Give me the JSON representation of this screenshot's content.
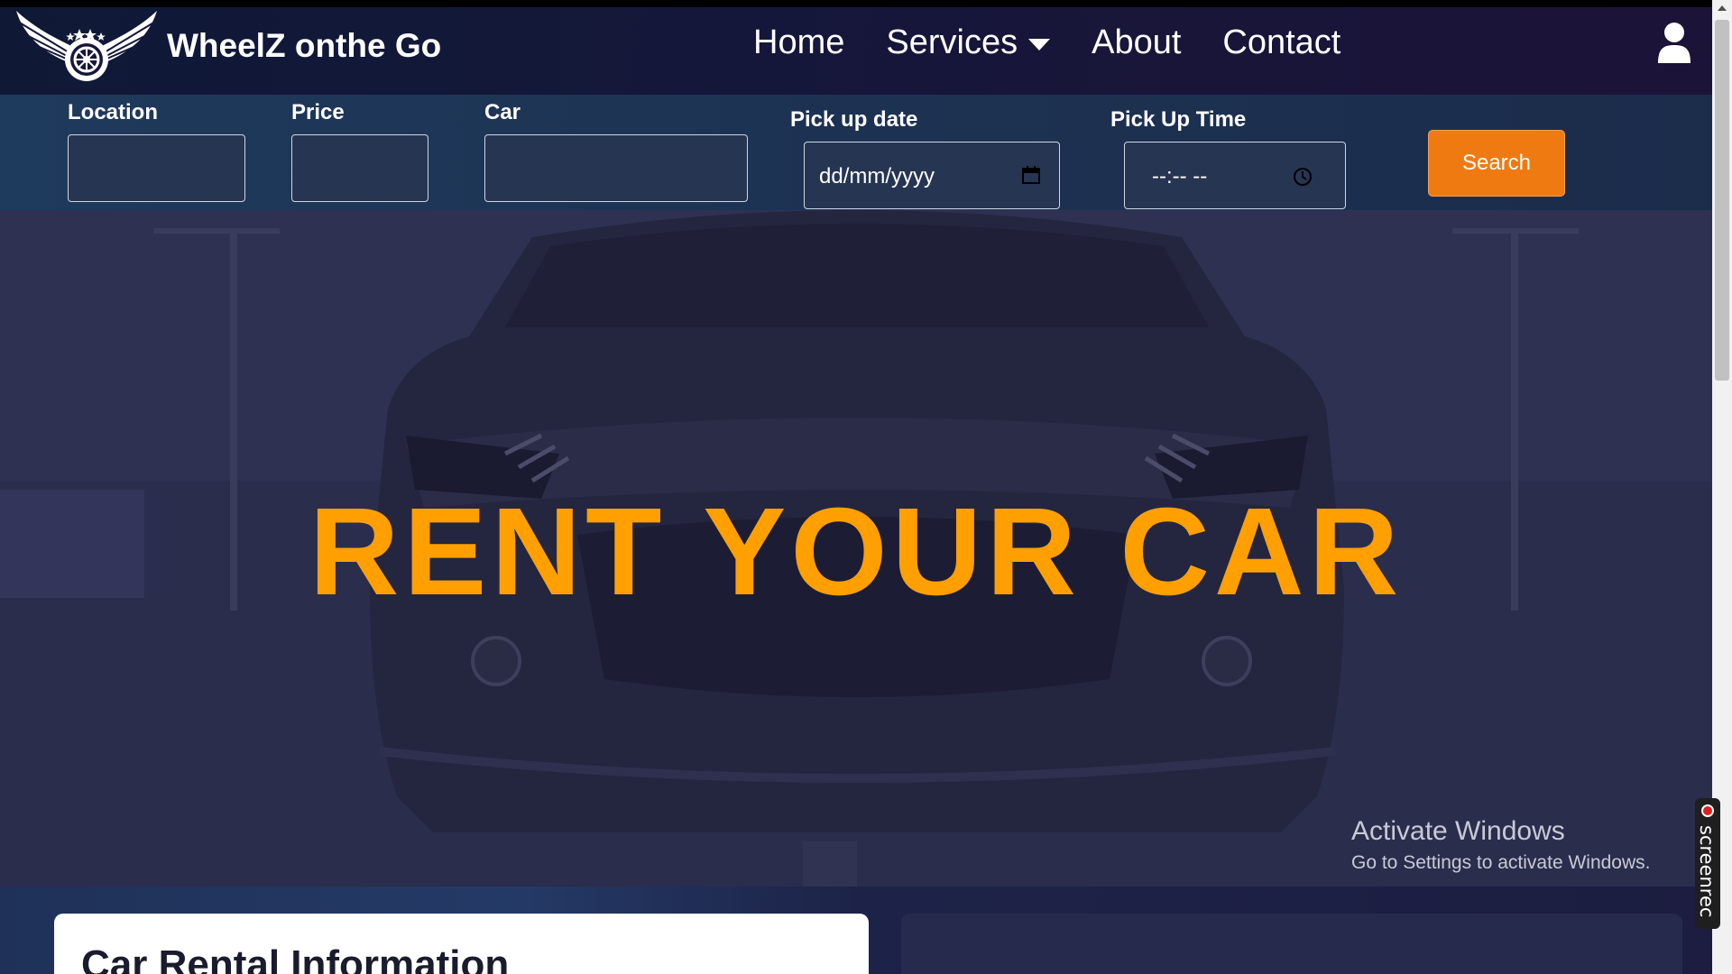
{
  "nav": {
    "brand": "WheelZ onthe Go",
    "links": [
      "Home",
      "Services",
      "About",
      "Contact"
    ],
    "user_icon": "user-icon"
  },
  "search": {
    "location_label": "Location",
    "location_value": "",
    "price_label": "Price",
    "price_value": "",
    "car_label": "Car",
    "car_value": "",
    "date_label": "Pick up date",
    "date_value": "dd/mm/yyyy",
    "time_label": "Pick Up Time",
    "time_value": "--:-- --",
    "button_label": "Search"
  },
  "hero": {
    "title": "RENT YOUR CAR"
  },
  "watermark": {
    "title": "Activate Windows",
    "subtitle": "Go to Settings to activate Windows."
  },
  "info": {
    "title": "Car Rental Information"
  },
  "screenrec": {
    "label": "screenrec"
  },
  "colors": {
    "accent": "#ffa000",
    "button": "#f07a12",
    "nav_bg": "#15173a"
  }
}
